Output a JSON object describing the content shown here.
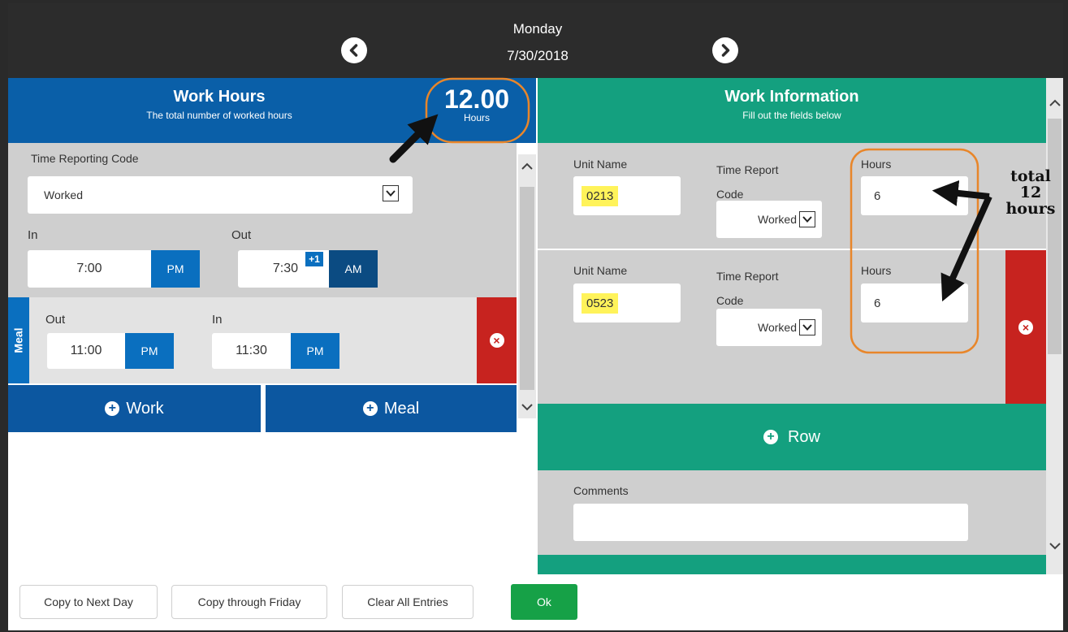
{
  "header": {
    "day": "Monday",
    "date": "7/30/2018",
    "prev_icon": "chevron-left-icon",
    "next_icon": "chevron-right-icon"
  },
  "work_hours": {
    "title": "Work Hours",
    "subtitle": "The total number of worked hours",
    "total": "12.00",
    "total_unit": "Hours",
    "time_reporting_code_label": "Time Reporting Code",
    "time_reporting_code_value": "Worked",
    "in_label": "In",
    "in_time": "7:00",
    "in_ampm": "PM",
    "out_label": "Out",
    "out_time": "7:30",
    "out_badge": "+1",
    "out_ampm": "AM",
    "meal": {
      "tab": "Meal",
      "out_label": "Out",
      "out_time": "11:00",
      "out_ampm": "PM",
      "in_label": "In",
      "in_time": "11:30",
      "in_ampm": "PM"
    },
    "add_work": "Work",
    "add_meal": "Meal"
  },
  "work_info": {
    "title": "Work Information",
    "subtitle": "Fill out the fields below",
    "rows": [
      {
        "unit_label": "Unit Name",
        "unit": "0213",
        "code_label": "Time Report Code",
        "code": "Worked",
        "hours_label": "Hours",
        "hours": "6"
      },
      {
        "unit_label": "Unit Name",
        "unit": "0523",
        "code_label": "Time Report Code",
        "code": "Worked",
        "hours_label": "Hours",
        "hours": "6"
      }
    ],
    "add_row": "Row",
    "comments_label": "Comments",
    "comments_value": ""
  },
  "annotation": {
    "line1": "total",
    "line2": "12",
    "line3": "hours"
  },
  "footer": {
    "copy_next": "Copy to Next Day",
    "copy_friday": "Copy through Friday",
    "clear_all": "Clear All Entries",
    "ok": "Ok"
  },
  "colors": {
    "header": "#2c2c2c",
    "blue": "#0a5fa8",
    "green": "#14a07f",
    "red": "#c7231f",
    "ok": "#16a147",
    "annotation_ring": "#e8862a"
  }
}
